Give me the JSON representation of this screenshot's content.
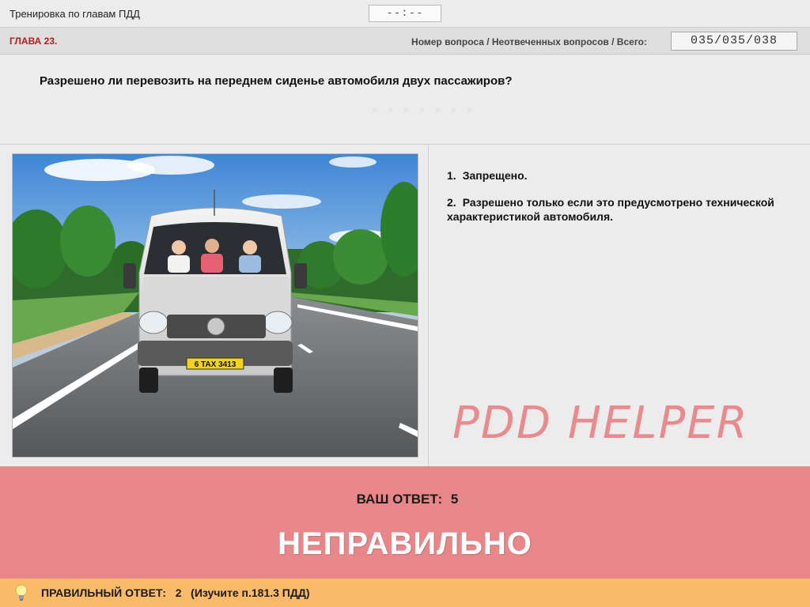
{
  "window": {
    "title": "Тренировка по главам ПДД",
    "timer": "--:--"
  },
  "header": {
    "chapter": "ГЛАВА 23.",
    "counter_label": "Номер вопроса / Неотвеченных вопросов / Всего:",
    "counter_value": "035/035/038"
  },
  "question": {
    "text": "Разрешено ли перевозить на переднем сиденье автомобиля двух пассажиров?"
  },
  "image": {
    "license_plate": "6 TAX 3413"
  },
  "answers": [
    {
      "number": "1.",
      "text": "Запрещено."
    },
    {
      "number": "2.",
      "text": "Разрешено только если это предусмотрено технической характеристикой автомобиля."
    }
  ],
  "watermark": "PDD HELPER",
  "result": {
    "your_answer_label": "ВАШ ОТВЕТ:",
    "your_answer_value": "5",
    "verdict": "НЕПРАВИЛЬНО",
    "color": "#e88789"
  },
  "correct": {
    "text": "ПРАВИЛЬНЫЙ ОТВЕТ:   2   (Изучите п.181.3 ПДД)",
    "icon": "lightbulb-icon",
    "color": "#f9bb6a"
  }
}
